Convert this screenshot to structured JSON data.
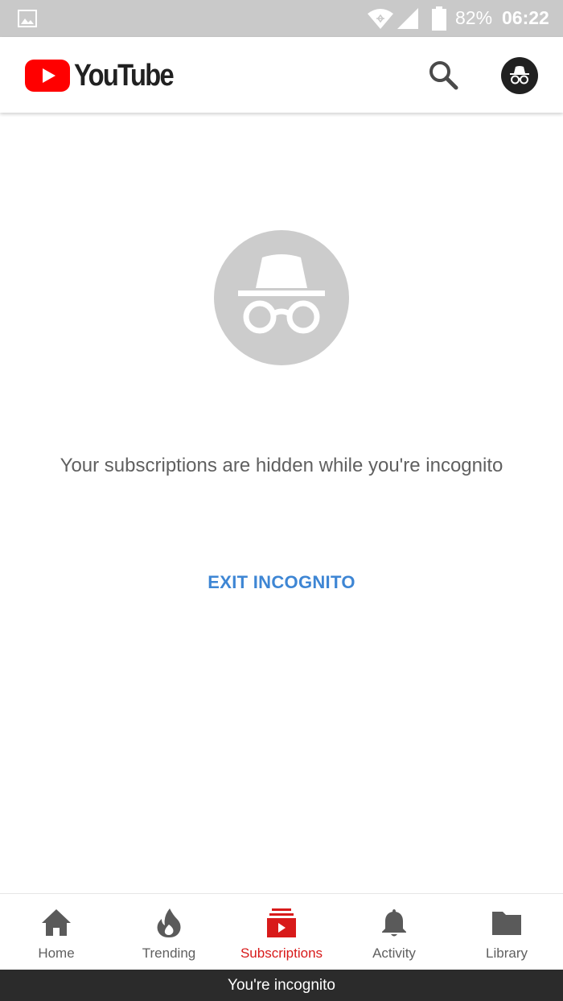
{
  "status_bar": {
    "battery_percent": "82%",
    "time": "06:22",
    "icons": [
      "gallery-icon",
      "wifi-icon",
      "signal-icon",
      "battery-icon"
    ]
  },
  "app_bar": {
    "brand_name": "YouTube",
    "brand_color": "#ff0000",
    "icons": [
      "youtube-logo-icon",
      "search-icon",
      "incognito-avatar-icon"
    ]
  },
  "main": {
    "icon": "incognito-icon",
    "message": "Your subscriptions are hidden while you're incognito",
    "exit_label": "EXIT INCOGNITO",
    "exit_color": "#3e86d4"
  },
  "bottom_nav": {
    "active_color": "#d81a1a",
    "items": [
      {
        "label": "Home",
        "icon": "home-icon"
      },
      {
        "label": "Trending",
        "icon": "trending-flame-icon"
      },
      {
        "label": "Subscriptions",
        "icon": "subscriptions-icon",
        "active": true
      },
      {
        "label": "Activity",
        "icon": "bell-icon"
      },
      {
        "label": "Library",
        "icon": "folder-icon"
      }
    ]
  },
  "incognito_bar": {
    "text": "You're incognito"
  }
}
